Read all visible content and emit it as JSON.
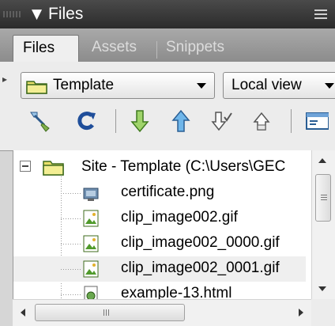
{
  "panel": {
    "title": "Files",
    "collapse_icon": "triangle-down-icon",
    "menu_icon": "panel-options-icon"
  },
  "tabs": [
    {
      "label": "Files",
      "active": true
    },
    {
      "label": "Assets",
      "active": false
    },
    {
      "label": "Snippets",
      "active": false
    }
  ],
  "toolbar": {
    "site_select": {
      "value": "Template",
      "icon": "folder-icon"
    },
    "view_select": {
      "value": "Local view"
    },
    "buttons": [
      {
        "name": "connect-icon"
      },
      {
        "name": "refresh-icon"
      },
      {
        "name": "get-files-icon"
      },
      {
        "name": "put-files-icon"
      },
      {
        "name": "check-out-icon"
      },
      {
        "name": "check-in-icon"
      },
      {
        "name": "expand-panel-icon"
      }
    ]
  },
  "tree": {
    "root": {
      "label": "Site - Template (C:\\Users\\GEC",
      "icon": "folder-icon"
    },
    "items": [
      {
        "label": "certificate.png",
        "icon": "png-file-icon",
        "selected": false
      },
      {
        "label": "clip_image002.gif",
        "icon": "gif-file-icon",
        "selected": false
      },
      {
        "label": "clip_image002_0000.gif",
        "icon": "gif-file-icon",
        "selected": false
      },
      {
        "label": "clip_image002_0001.gif",
        "icon": "gif-file-icon",
        "selected": true
      },
      {
        "label": "example-13.html",
        "icon": "html-file-icon",
        "selected": false
      }
    ]
  },
  "colors": {
    "title_bar": "#333333",
    "tab_strip": "#999999",
    "toolbar": "#ececec",
    "selection": "#efefef"
  }
}
